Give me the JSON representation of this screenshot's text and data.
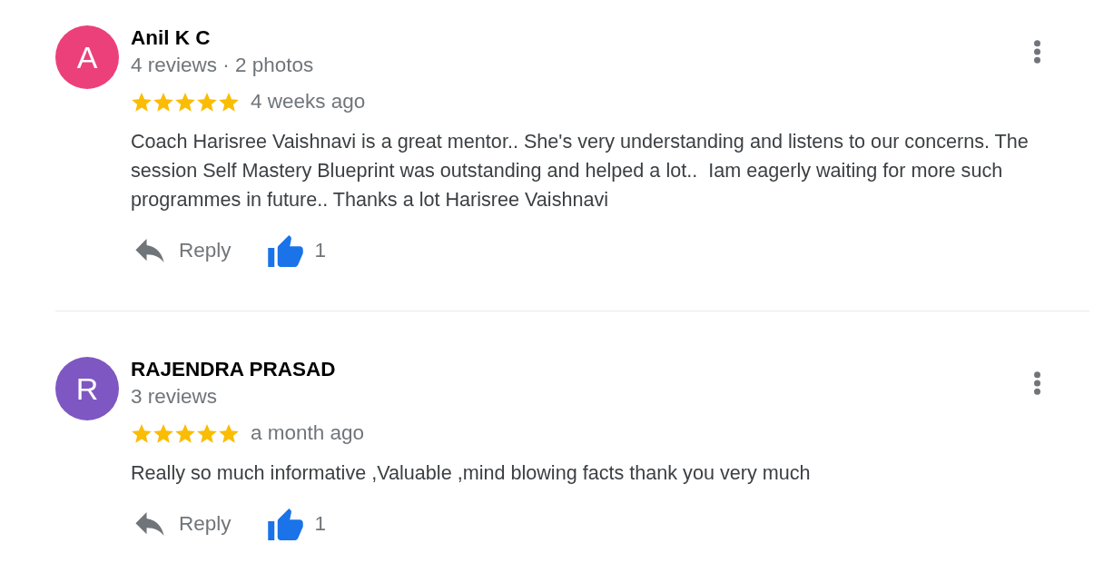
{
  "reviews": [
    {
      "avatar": {
        "initial": "A",
        "color": "#ec407a"
      },
      "name": "Anil K C",
      "meta": "4 reviews · 2 photos",
      "stars": 5,
      "time": "4 weeks ago",
      "text": "Coach Harisree Vaishnavi is a great mentor.. She's very understanding and listens to our concerns. The session Self Mastery Blueprint was outstanding and helped a lot..  Iam eagerly waiting for more such programmes in future.. Thanks a lot Harisree Vaishnavi",
      "reply": "Reply",
      "likes": "1",
      "liked": true
    },
    {
      "avatar": {
        "initial": "R",
        "color": "#7e57c2"
      },
      "name": "RAJENDRA PRASAD",
      "meta": "3 reviews",
      "stars": 5,
      "time": "a month ago",
      "text": "Really so much informative ,Valuable ,mind blowing facts thank you very much",
      "reply": "Reply",
      "likes": "1",
      "liked": true
    }
  ]
}
